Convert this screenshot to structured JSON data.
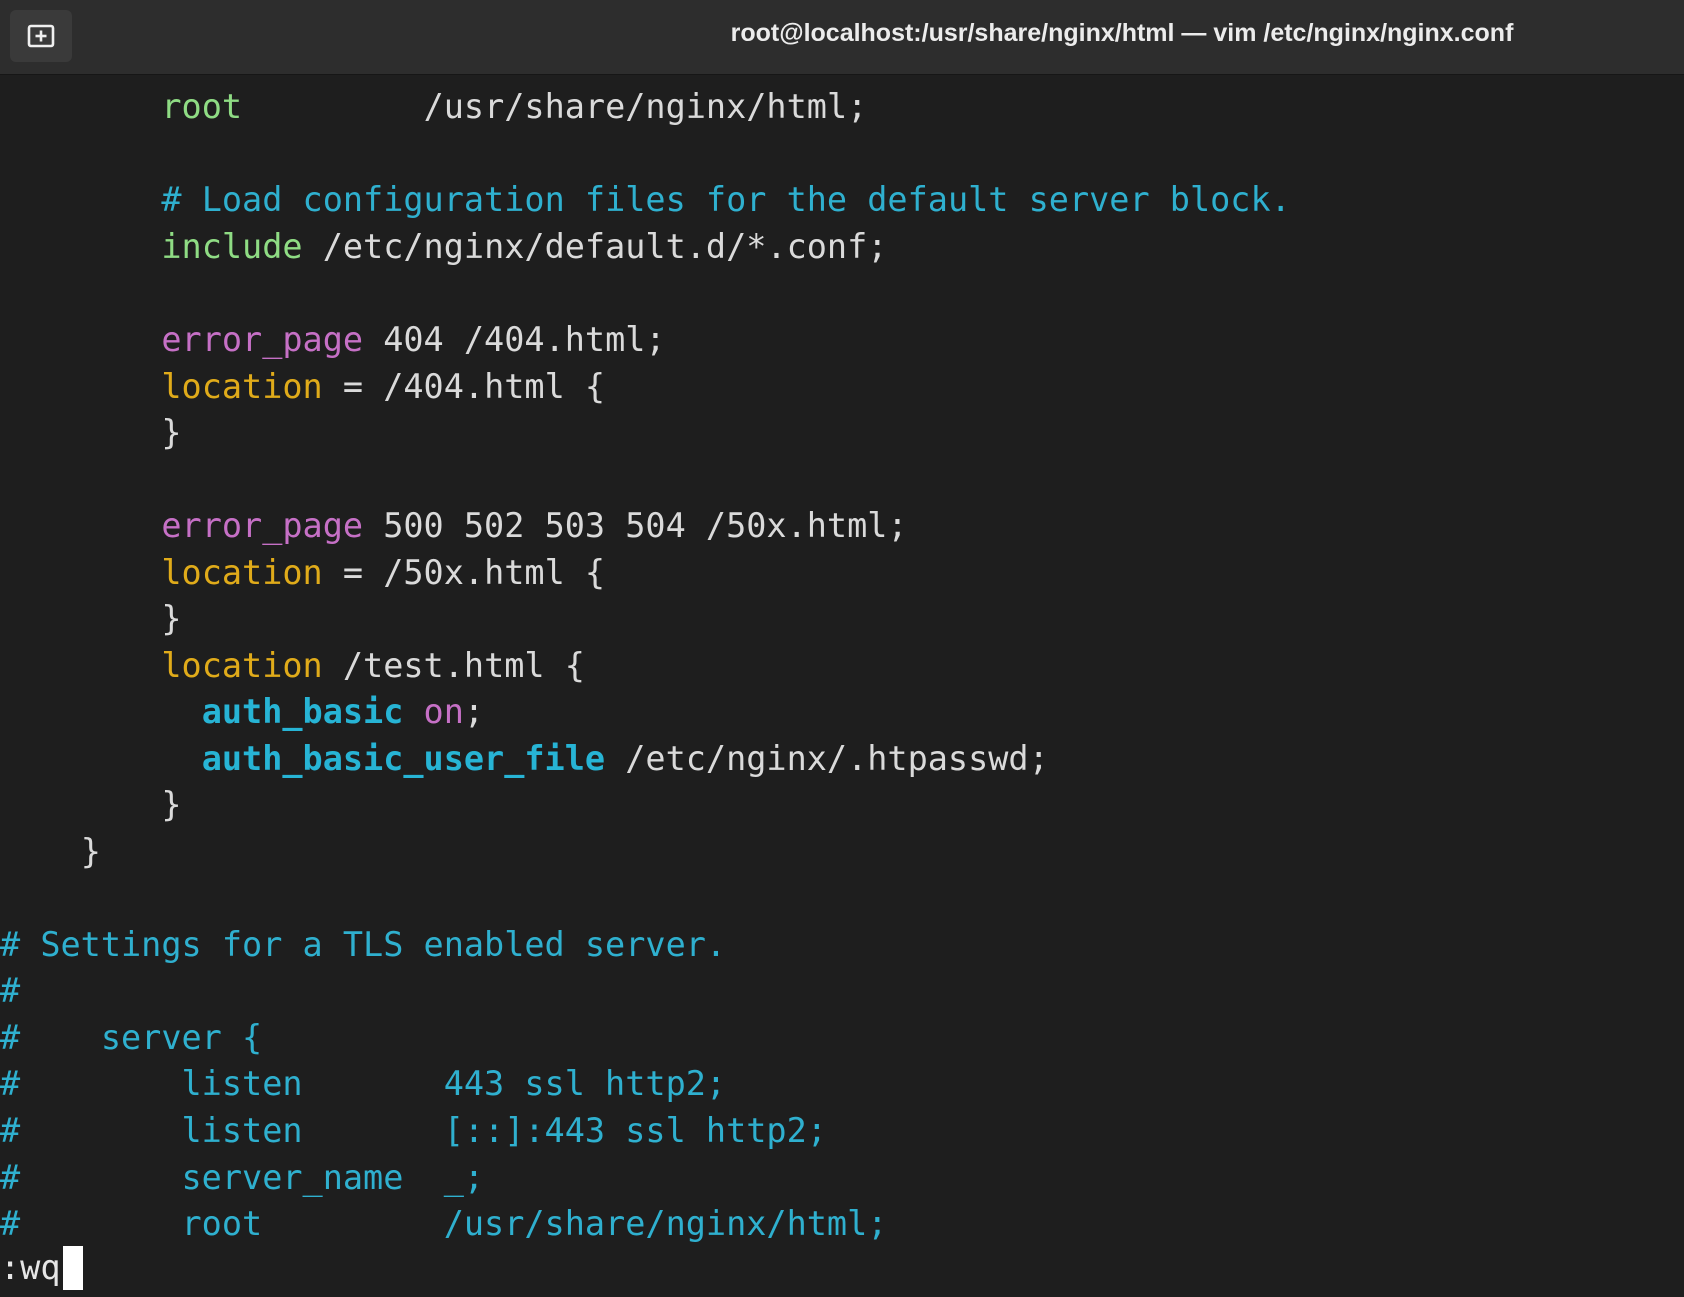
{
  "window": {
    "title": "root@localhost:/usr/share/nginx/html — vim /etc/nginx/nginx.conf",
    "new_tab_icon": "new-tab-icon"
  },
  "editor": {
    "lines": {
      "l1": {
        "indent": "        ",
        "tok1": "root",
        "rest": "         /usr/share/nginx/html;"
      },
      "l3": {
        "indent": "        ",
        "comment": "# Load configuration files for the default server block."
      },
      "l4": {
        "indent": "        ",
        "tok1": "include",
        "rest": " /etc/nginx/default.d/*.conf;"
      },
      "l6": {
        "indent": "        ",
        "tok1": "error_page",
        "rest": " 404 /404.html;"
      },
      "l7": {
        "indent": "        ",
        "tok1": "location",
        "rest": " = /404.html {"
      },
      "l8": {
        "indent": "        ",
        "rest": "}"
      },
      "l10": {
        "indent": "        ",
        "tok1": "error_page",
        "rest": " 500 502 503 504 /50x.html;"
      },
      "l11": {
        "indent": "        ",
        "tok1": "location",
        "rest": " = /50x.html {"
      },
      "l12": {
        "indent": "        ",
        "rest": "}"
      },
      "l13": {
        "indent": "        ",
        "tok1": "location",
        "rest": " /test.html {"
      },
      "l14": {
        "indent": "          ",
        "tok1": "auth_basic",
        "mid": " ",
        "tok2": "on",
        "rest": ";"
      },
      "l15": {
        "indent": "          ",
        "tok1": "auth_basic_user_file",
        "rest": " /etc/nginx/.htpasswd;"
      },
      "l16": {
        "indent": "        ",
        "rest": "}"
      },
      "l17": {
        "indent": "    ",
        "rest": "}"
      },
      "l19": {
        "comment": "# Settings for a TLS enabled server."
      },
      "l20": {
        "comment": "#"
      },
      "l21": {
        "comment": "#    server {"
      },
      "l22": {
        "comment": "#        listen       443 ssl http2;"
      },
      "l23": {
        "comment": "#        listen       [::]:443 ssl http2;"
      },
      "l24": {
        "comment": "#        server_name  _;"
      },
      "l25": {
        "comment": "#        root         /usr/share/nginx/html;"
      }
    }
  },
  "command_line": {
    "text": ":wq"
  },
  "colors": {
    "background": "#1e1e1e",
    "titlebar": "#2d2d2d",
    "keyword_green": "#8fdc84",
    "keyword_magenta": "#c670c6",
    "keyword_yellow": "#e0ab1a",
    "keyword_cyan": "#27b4d5",
    "comment": "#2fb0cf",
    "text": "#dadada"
  }
}
